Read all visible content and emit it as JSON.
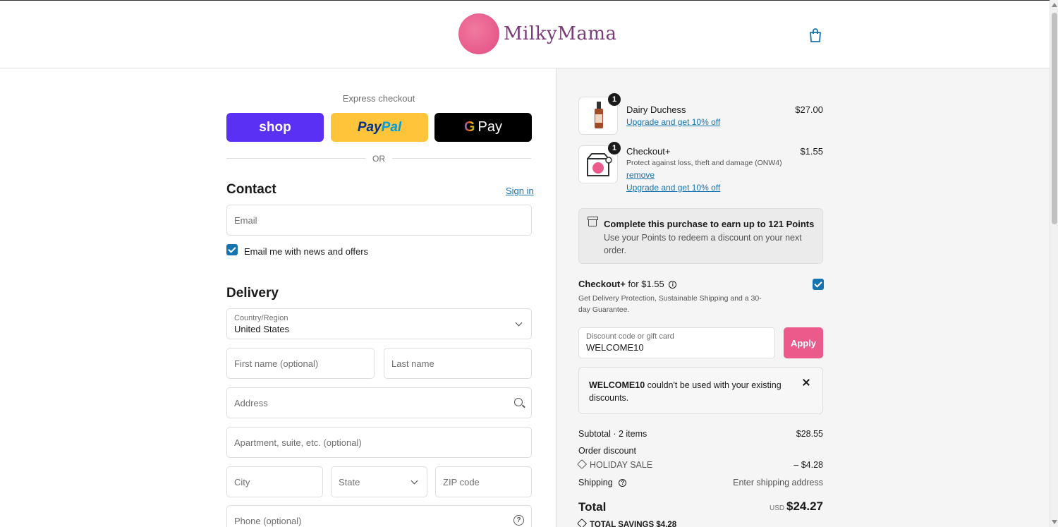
{
  "header": {
    "logo_text": "MilkyMama"
  },
  "express": {
    "label": "Express checkout",
    "shop_label": "shop",
    "paypal_part1": "Pay",
    "paypal_part2": "Pal",
    "gpay_g": "G",
    "gpay_label": "Pay",
    "or_text": "OR"
  },
  "contact": {
    "title": "Contact",
    "sign_in": "Sign in",
    "email_placeholder": "Email",
    "news_label": "Email me with news and offers"
  },
  "delivery": {
    "title": "Delivery",
    "country_label": "Country/Region",
    "country_value": "United States",
    "first_name": "First name (optional)",
    "last_name": "Last name",
    "address": "Address",
    "apartment": "Apartment, suite, etc. (optional)",
    "city": "City",
    "state": "State",
    "zip": "ZIP code",
    "phone": "Phone (optional)",
    "help_glyph": "?"
  },
  "cart": {
    "items": [
      {
        "qty": "1",
        "name": "Dairy Duchess",
        "price": "$27.00",
        "upgrade": "Upgrade and get 10% off"
      },
      {
        "qty": "1",
        "name": "Checkout+",
        "price": "$1.55",
        "desc": "Protect against loss, theft and damage (ONW4)",
        "remove": "remove",
        "upgrade": "Upgrade and get 10% off"
      }
    ]
  },
  "points": {
    "title": "Complete this purchase to earn up to 121 Points",
    "text": "Use your Points to redeem a discount on your next order."
  },
  "checkout_plus": {
    "title_bold": "Checkout+",
    "title_rest": "for $1.55",
    "info_glyph": "i",
    "desc": "Get Delivery Protection, Sustainable Shipping and a 30-day Guarantee."
  },
  "discount": {
    "label": "Discount code or gift card",
    "value": "WELCOME10",
    "apply": "Apply",
    "error_code": "WELCOME10",
    "error_text": " couldn't be used with your existing discounts."
  },
  "summary": {
    "subtotal_label": "Subtotal · 2 items",
    "subtotal_value": "$28.55",
    "order_discount_label": "Order discount",
    "holiday_label": "HOLIDAY SALE",
    "holiday_value": "– $4.28",
    "shipping_label": "Shipping",
    "shipping_help": "?",
    "shipping_value": "Enter shipping address",
    "total_label": "Total",
    "currency": "USD",
    "total_value": "$24.27",
    "savings": "TOTAL SAVINGS  $4.28"
  },
  "colors": {
    "accent": "#1773b0",
    "brand_pink": "#ec5a8c",
    "shop_purple": "#5a31f4",
    "paypal_yellow": "#ffc439"
  }
}
